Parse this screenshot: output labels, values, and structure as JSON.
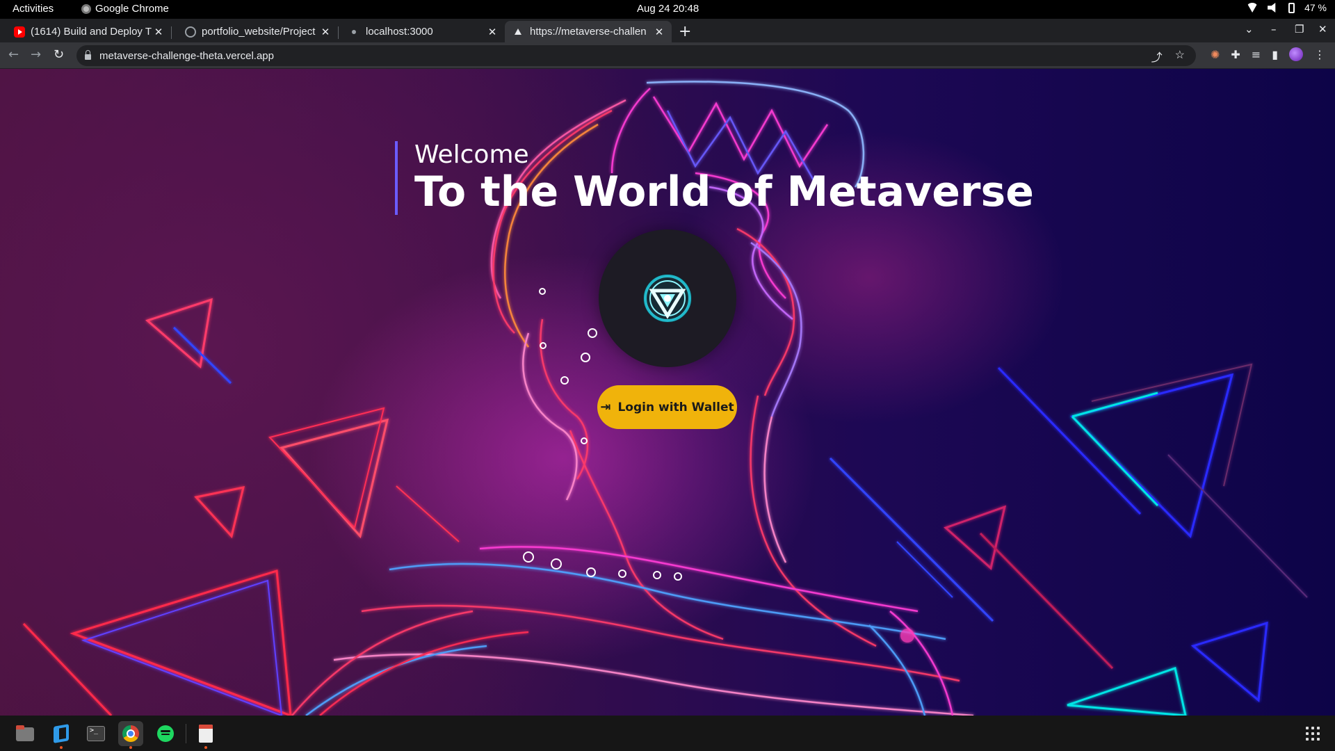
{
  "system_bar": {
    "activities": "Activities",
    "app_name": "Google Chrome",
    "clock": "Aug 24  20:48",
    "battery": "47 %"
  },
  "tabs": [
    {
      "title": "(1614) Build and Deploy T",
      "favicon": "youtube-icon",
      "active": false
    },
    {
      "title": "portfolio_website/Project",
      "favicon": "github-icon",
      "active": false
    },
    {
      "title": "localhost:3000",
      "favicon": "page-icon",
      "active": false
    },
    {
      "title": "https://metaverse-challen",
      "favicon": "vercel-icon",
      "active": true
    }
  ],
  "address_bar": {
    "url": "metaverse-challenge-theta.vercel.app"
  },
  "page": {
    "welcome": "Welcome",
    "headline": "To the World of Metaverse",
    "login_button": "Login with Wallet",
    "accent_color": "#f0b30b",
    "logo": "arc-reactor-icon"
  },
  "dock": [
    "files-icon",
    "vscode-icon",
    "terminal-icon",
    "chrome-icon",
    "spotify-icon",
    "text-editor-icon"
  ]
}
